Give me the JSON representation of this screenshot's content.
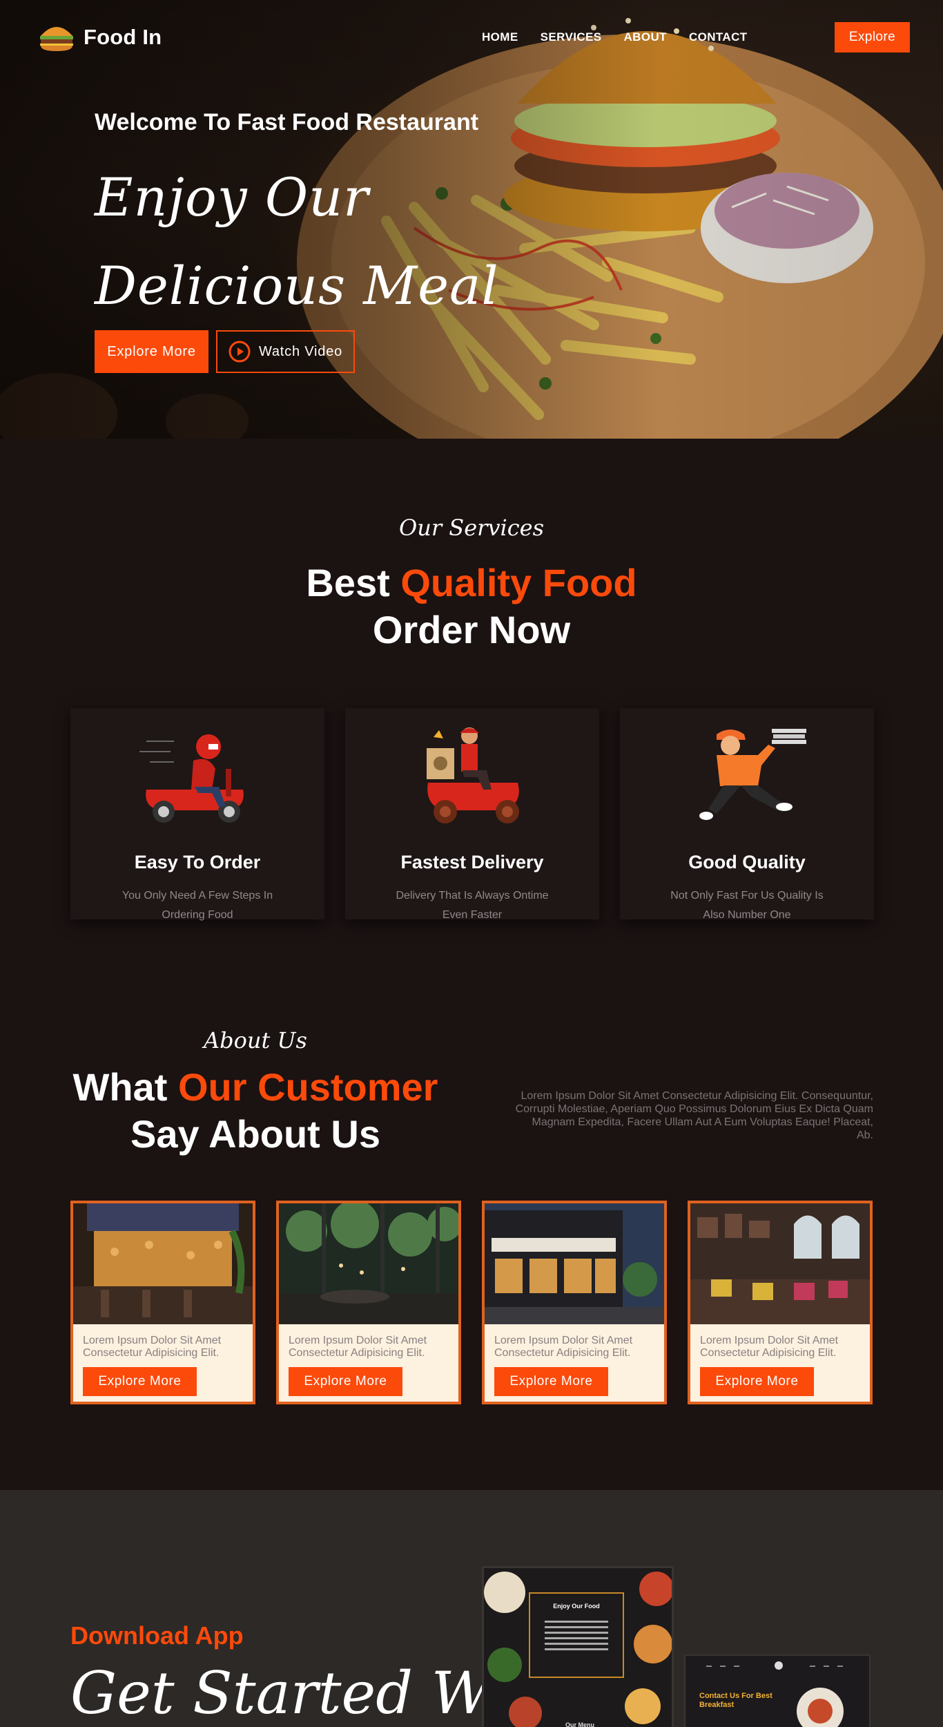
{
  "nav": {
    "logo_text": "Food In",
    "menu": [
      "HOME",
      "SERVICES",
      "ABOUT",
      "CONTACT"
    ],
    "cta": "Explore"
  },
  "hero": {
    "subtitle": "Welcome To Fast Food Restaurant",
    "title_line1": "Enjoy Our",
    "title_line2": "Delicious Meal",
    "primary_button": "Explore More",
    "secondary_button": "Watch Video"
  },
  "services": {
    "script_label": "Our Services",
    "title_part1": "Best ",
    "title_accent": "Quality Food",
    "title_line2": "Order Now",
    "cards": [
      {
        "title": "Easy To Order",
        "description": "You Only Need A Few Steps In Ordering Food",
        "icon": "scooter-rider-icon"
      },
      {
        "title": "Fastest Delivery",
        "description": "Delivery That Is Always Ontime Even Faster",
        "icon": "delivery-scooter-icon"
      },
      {
        "title": "Good Quality",
        "description": "Not Only Fast For Us Quality Is Also Number One",
        "icon": "pizza-courier-icon"
      }
    ]
  },
  "about": {
    "script_label": "About Us",
    "title_part1": "What ",
    "title_accent": "Our Customer",
    "title_line2": "Say About Us",
    "description": "Lorem Ipsum Dolor Sit Amet Consectetur Adipisicing Elit. Consequuntur, Corrupti Molestiae, Aperiam Quo Possimus Dolorum Eius Ex Dicta Quam Magnam Expedita, Facere Ullam Aut A Eum Voluptas Eaque! Placeat, Ab.",
    "cards": [
      {
        "text": "Lorem Ipsum Dolor Sit Amet Consectetur Adipisicing Elit.",
        "button": "Explore More"
      },
      {
        "text": "Lorem Ipsum Dolor Sit Amet Consectetur Adipisicing Elit.",
        "button": "Explore More"
      },
      {
        "text": "Lorem Ipsum Dolor Sit Amet Consectetur Adipisicing Elit.",
        "button": "Explore More"
      },
      {
        "text": "Lorem Ipsum Dolor Sit Amet Consectetur Adipisicing Elit.",
        "button": "Explore More"
      }
    ]
  },
  "download": {
    "label": "Download App",
    "title": "Get Started With",
    "phone1_title": "Enjoy Our Food",
    "phone1_menu": "Our Menu",
    "phone2_title": "Contact Us For Best Breakfast"
  },
  "colors": {
    "accent": "#fc4a0b",
    "background": "#1b1212",
    "card_border": "#e0621f",
    "card_fill": "#fdf1e0"
  }
}
